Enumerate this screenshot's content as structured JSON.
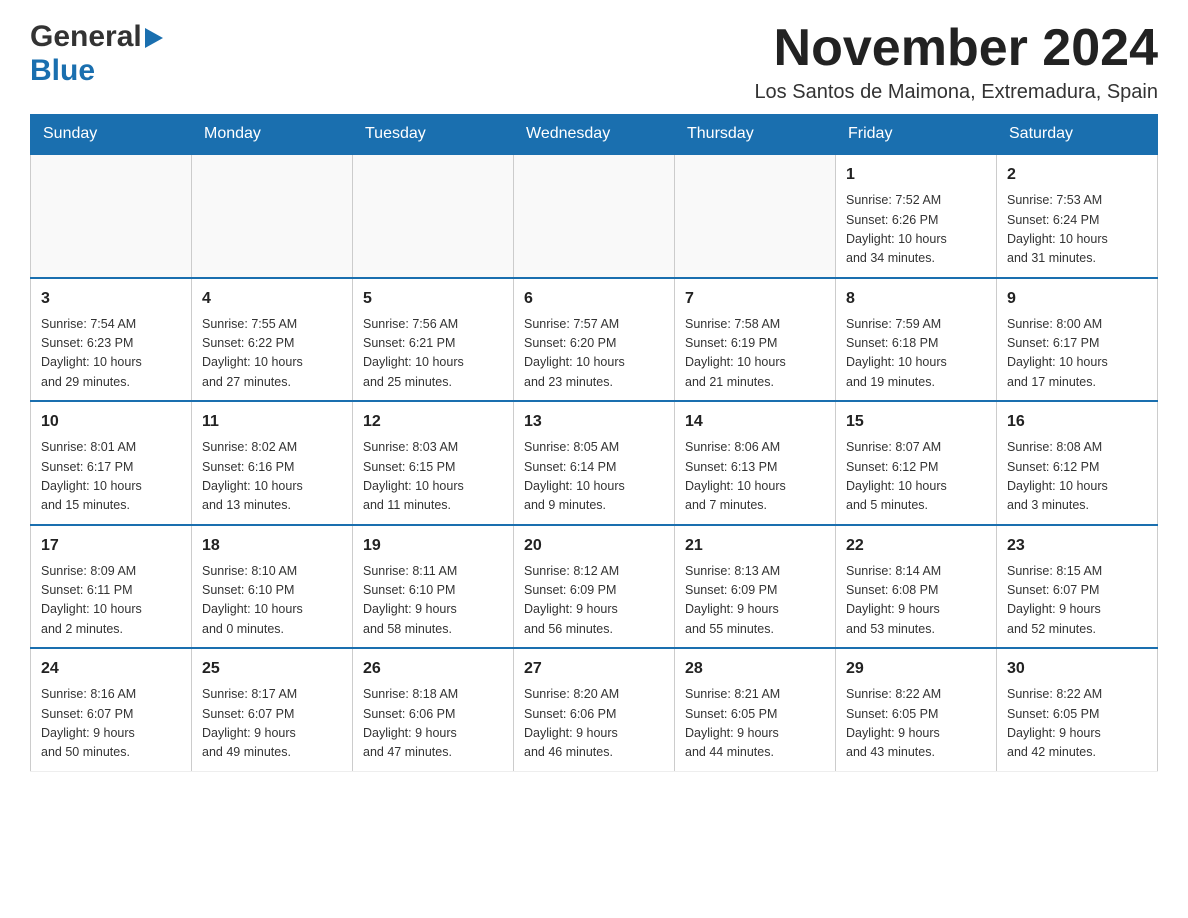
{
  "logo": {
    "general": "General",
    "blue": "Blue",
    "arrow": "▶"
  },
  "header": {
    "month_title": "November 2024",
    "location": "Los Santos de Maimona, Extremadura, Spain"
  },
  "weekdays": [
    "Sunday",
    "Monday",
    "Tuesday",
    "Wednesday",
    "Thursday",
    "Friday",
    "Saturday"
  ],
  "weeks": [
    [
      {
        "day": "",
        "info": ""
      },
      {
        "day": "",
        "info": ""
      },
      {
        "day": "",
        "info": ""
      },
      {
        "day": "",
        "info": ""
      },
      {
        "day": "",
        "info": ""
      },
      {
        "day": "1",
        "info": "Sunrise: 7:52 AM\nSunset: 6:26 PM\nDaylight: 10 hours\nand 34 minutes."
      },
      {
        "day": "2",
        "info": "Sunrise: 7:53 AM\nSunset: 6:24 PM\nDaylight: 10 hours\nand 31 minutes."
      }
    ],
    [
      {
        "day": "3",
        "info": "Sunrise: 7:54 AM\nSunset: 6:23 PM\nDaylight: 10 hours\nand 29 minutes."
      },
      {
        "day": "4",
        "info": "Sunrise: 7:55 AM\nSunset: 6:22 PM\nDaylight: 10 hours\nand 27 minutes."
      },
      {
        "day": "5",
        "info": "Sunrise: 7:56 AM\nSunset: 6:21 PM\nDaylight: 10 hours\nand 25 minutes."
      },
      {
        "day": "6",
        "info": "Sunrise: 7:57 AM\nSunset: 6:20 PM\nDaylight: 10 hours\nand 23 minutes."
      },
      {
        "day": "7",
        "info": "Sunrise: 7:58 AM\nSunset: 6:19 PM\nDaylight: 10 hours\nand 21 minutes."
      },
      {
        "day": "8",
        "info": "Sunrise: 7:59 AM\nSunset: 6:18 PM\nDaylight: 10 hours\nand 19 minutes."
      },
      {
        "day": "9",
        "info": "Sunrise: 8:00 AM\nSunset: 6:17 PM\nDaylight: 10 hours\nand 17 minutes."
      }
    ],
    [
      {
        "day": "10",
        "info": "Sunrise: 8:01 AM\nSunset: 6:17 PM\nDaylight: 10 hours\nand 15 minutes."
      },
      {
        "day": "11",
        "info": "Sunrise: 8:02 AM\nSunset: 6:16 PM\nDaylight: 10 hours\nand 13 minutes."
      },
      {
        "day": "12",
        "info": "Sunrise: 8:03 AM\nSunset: 6:15 PM\nDaylight: 10 hours\nand 11 minutes."
      },
      {
        "day": "13",
        "info": "Sunrise: 8:05 AM\nSunset: 6:14 PM\nDaylight: 10 hours\nand 9 minutes."
      },
      {
        "day": "14",
        "info": "Sunrise: 8:06 AM\nSunset: 6:13 PM\nDaylight: 10 hours\nand 7 minutes."
      },
      {
        "day": "15",
        "info": "Sunrise: 8:07 AM\nSunset: 6:12 PM\nDaylight: 10 hours\nand 5 minutes."
      },
      {
        "day": "16",
        "info": "Sunrise: 8:08 AM\nSunset: 6:12 PM\nDaylight: 10 hours\nand 3 minutes."
      }
    ],
    [
      {
        "day": "17",
        "info": "Sunrise: 8:09 AM\nSunset: 6:11 PM\nDaylight: 10 hours\nand 2 minutes."
      },
      {
        "day": "18",
        "info": "Sunrise: 8:10 AM\nSunset: 6:10 PM\nDaylight: 10 hours\nand 0 minutes."
      },
      {
        "day": "19",
        "info": "Sunrise: 8:11 AM\nSunset: 6:10 PM\nDaylight: 9 hours\nand 58 minutes."
      },
      {
        "day": "20",
        "info": "Sunrise: 8:12 AM\nSunset: 6:09 PM\nDaylight: 9 hours\nand 56 minutes."
      },
      {
        "day": "21",
        "info": "Sunrise: 8:13 AM\nSunset: 6:09 PM\nDaylight: 9 hours\nand 55 minutes."
      },
      {
        "day": "22",
        "info": "Sunrise: 8:14 AM\nSunset: 6:08 PM\nDaylight: 9 hours\nand 53 minutes."
      },
      {
        "day": "23",
        "info": "Sunrise: 8:15 AM\nSunset: 6:07 PM\nDaylight: 9 hours\nand 52 minutes."
      }
    ],
    [
      {
        "day": "24",
        "info": "Sunrise: 8:16 AM\nSunset: 6:07 PM\nDaylight: 9 hours\nand 50 minutes."
      },
      {
        "day": "25",
        "info": "Sunrise: 8:17 AM\nSunset: 6:07 PM\nDaylight: 9 hours\nand 49 minutes."
      },
      {
        "day": "26",
        "info": "Sunrise: 8:18 AM\nSunset: 6:06 PM\nDaylight: 9 hours\nand 47 minutes."
      },
      {
        "day": "27",
        "info": "Sunrise: 8:20 AM\nSunset: 6:06 PM\nDaylight: 9 hours\nand 46 minutes."
      },
      {
        "day": "28",
        "info": "Sunrise: 8:21 AM\nSunset: 6:05 PM\nDaylight: 9 hours\nand 44 minutes."
      },
      {
        "day": "29",
        "info": "Sunrise: 8:22 AM\nSunset: 6:05 PM\nDaylight: 9 hours\nand 43 minutes."
      },
      {
        "day": "30",
        "info": "Sunrise: 8:22 AM\nSunset: 6:05 PM\nDaylight: 9 hours\nand 42 minutes."
      }
    ]
  ]
}
